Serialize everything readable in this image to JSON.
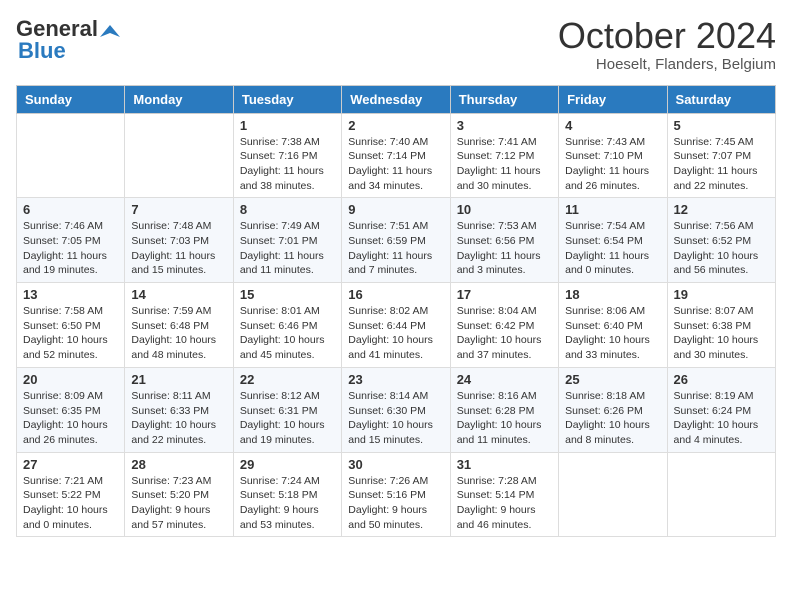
{
  "header": {
    "logo_general": "General",
    "logo_blue": "Blue",
    "month_title": "October 2024",
    "location": "Hoeselt, Flanders, Belgium"
  },
  "days_of_week": [
    "Sunday",
    "Monday",
    "Tuesday",
    "Wednesday",
    "Thursday",
    "Friday",
    "Saturday"
  ],
  "weeks": [
    [
      {
        "day": "",
        "sunrise": "",
        "sunset": "",
        "daylight": ""
      },
      {
        "day": "",
        "sunrise": "",
        "sunset": "",
        "daylight": ""
      },
      {
        "day": "1",
        "sunrise": "Sunrise: 7:38 AM",
        "sunset": "Sunset: 7:16 PM",
        "daylight": "Daylight: 11 hours and 38 minutes."
      },
      {
        "day": "2",
        "sunrise": "Sunrise: 7:40 AM",
        "sunset": "Sunset: 7:14 PM",
        "daylight": "Daylight: 11 hours and 34 minutes."
      },
      {
        "day": "3",
        "sunrise": "Sunrise: 7:41 AM",
        "sunset": "Sunset: 7:12 PM",
        "daylight": "Daylight: 11 hours and 30 minutes."
      },
      {
        "day": "4",
        "sunrise": "Sunrise: 7:43 AM",
        "sunset": "Sunset: 7:10 PM",
        "daylight": "Daylight: 11 hours and 26 minutes."
      },
      {
        "day": "5",
        "sunrise": "Sunrise: 7:45 AM",
        "sunset": "Sunset: 7:07 PM",
        "daylight": "Daylight: 11 hours and 22 minutes."
      }
    ],
    [
      {
        "day": "6",
        "sunrise": "Sunrise: 7:46 AM",
        "sunset": "Sunset: 7:05 PM",
        "daylight": "Daylight: 11 hours and 19 minutes."
      },
      {
        "day": "7",
        "sunrise": "Sunrise: 7:48 AM",
        "sunset": "Sunset: 7:03 PM",
        "daylight": "Daylight: 11 hours and 15 minutes."
      },
      {
        "day": "8",
        "sunrise": "Sunrise: 7:49 AM",
        "sunset": "Sunset: 7:01 PM",
        "daylight": "Daylight: 11 hours and 11 minutes."
      },
      {
        "day": "9",
        "sunrise": "Sunrise: 7:51 AM",
        "sunset": "Sunset: 6:59 PM",
        "daylight": "Daylight: 11 hours and 7 minutes."
      },
      {
        "day": "10",
        "sunrise": "Sunrise: 7:53 AM",
        "sunset": "Sunset: 6:56 PM",
        "daylight": "Daylight: 11 hours and 3 minutes."
      },
      {
        "day": "11",
        "sunrise": "Sunrise: 7:54 AM",
        "sunset": "Sunset: 6:54 PM",
        "daylight": "Daylight: 11 hours and 0 minutes."
      },
      {
        "day": "12",
        "sunrise": "Sunrise: 7:56 AM",
        "sunset": "Sunset: 6:52 PM",
        "daylight": "Daylight: 10 hours and 56 minutes."
      }
    ],
    [
      {
        "day": "13",
        "sunrise": "Sunrise: 7:58 AM",
        "sunset": "Sunset: 6:50 PM",
        "daylight": "Daylight: 10 hours and 52 minutes."
      },
      {
        "day": "14",
        "sunrise": "Sunrise: 7:59 AM",
        "sunset": "Sunset: 6:48 PM",
        "daylight": "Daylight: 10 hours and 48 minutes."
      },
      {
        "day": "15",
        "sunrise": "Sunrise: 8:01 AM",
        "sunset": "Sunset: 6:46 PM",
        "daylight": "Daylight: 10 hours and 45 minutes."
      },
      {
        "day": "16",
        "sunrise": "Sunrise: 8:02 AM",
        "sunset": "Sunset: 6:44 PM",
        "daylight": "Daylight: 10 hours and 41 minutes."
      },
      {
        "day": "17",
        "sunrise": "Sunrise: 8:04 AM",
        "sunset": "Sunset: 6:42 PM",
        "daylight": "Daylight: 10 hours and 37 minutes."
      },
      {
        "day": "18",
        "sunrise": "Sunrise: 8:06 AM",
        "sunset": "Sunset: 6:40 PM",
        "daylight": "Daylight: 10 hours and 33 minutes."
      },
      {
        "day": "19",
        "sunrise": "Sunrise: 8:07 AM",
        "sunset": "Sunset: 6:38 PM",
        "daylight": "Daylight: 10 hours and 30 minutes."
      }
    ],
    [
      {
        "day": "20",
        "sunrise": "Sunrise: 8:09 AM",
        "sunset": "Sunset: 6:35 PM",
        "daylight": "Daylight: 10 hours and 26 minutes."
      },
      {
        "day": "21",
        "sunrise": "Sunrise: 8:11 AM",
        "sunset": "Sunset: 6:33 PM",
        "daylight": "Daylight: 10 hours and 22 minutes."
      },
      {
        "day": "22",
        "sunrise": "Sunrise: 8:12 AM",
        "sunset": "Sunset: 6:31 PM",
        "daylight": "Daylight: 10 hours and 19 minutes."
      },
      {
        "day": "23",
        "sunrise": "Sunrise: 8:14 AM",
        "sunset": "Sunset: 6:30 PM",
        "daylight": "Daylight: 10 hours and 15 minutes."
      },
      {
        "day": "24",
        "sunrise": "Sunrise: 8:16 AM",
        "sunset": "Sunset: 6:28 PM",
        "daylight": "Daylight: 10 hours and 11 minutes."
      },
      {
        "day": "25",
        "sunrise": "Sunrise: 8:18 AM",
        "sunset": "Sunset: 6:26 PM",
        "daylight": "Daylight: 10 hours and 8 minutes."
      },
      {
        "day": "26",
        "sunrise": "Sunrise: 8:19 AM",
        "sunset": "Sunset: 6:24 PM",
        "daylight": "Daylight: 10 hours and 4 minutes."
      }
    ],
    [
      {
        "day": "27",
        "sunrise": "Sunrise: 7:21 AM",
        "sunset": "Sunset: 5:22 PM",
        "daylight": "Daylight: 10 hours and 0 minutes."
      },
      {
        "day": "28",
        "sunrise": "Sunrise: 7:23 AM",
        "sunset": "Sunset: 5:20 PM",
        "daylight": "Daylight: 9 hours and 57 minutes."
      },
      {
        "day": "29",
        "sunrise": "Sunrise: 7:24 AM",
        "sunset": "Sunset: 5:18 PM",
        "daylight": "Daylight: 9 hours and 53 minutes."
      },
      {
        "day": "30",
        "sunrise": "Sunrise: 7:26 AM",
        "sunset": "Sunset: 5:16 PM",
        "daylight": "Daylight: 9 hours and 50 minutes."
      },
      {
        "day": "31",
        "sunrise": "Sunrise: 7:28 AM",
        "sunset": "Sunset: 5:14 PM",
        "daylight": "Daylight: 9 hours and 46 minutes."
      },
      {
        "day": "",
        "sunrise": "",
        "sunset": "",
        "daylight": ""
      },
      {
        "day": "",
        "sunrise": "",
        "sunset": "",
        "daylight": ""
      }
    ]
  ]
}
